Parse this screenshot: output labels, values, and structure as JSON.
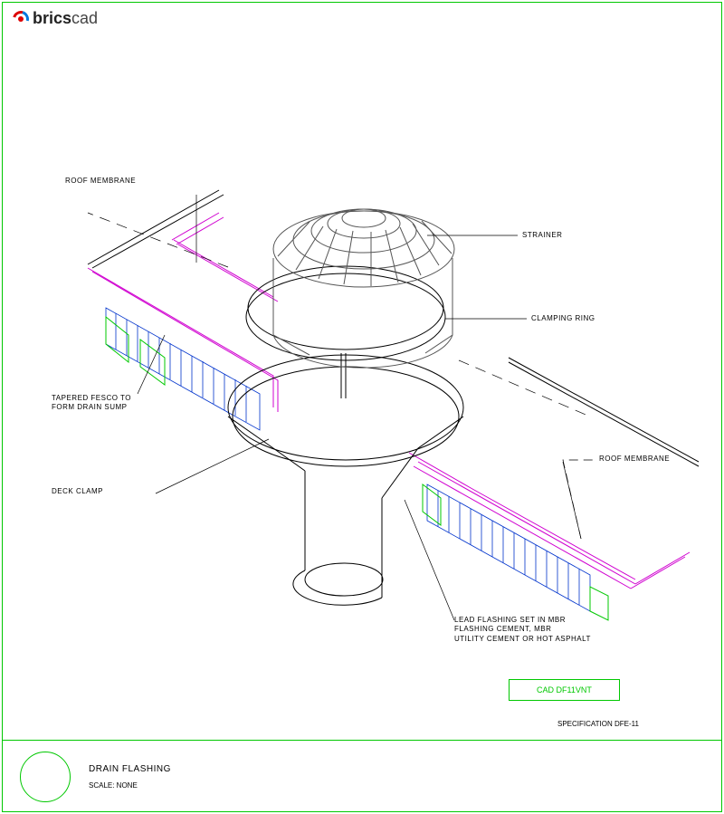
{
  "brand": {
    "prefix": "brics",
    "suffix": "cad"
  },
  "callouts": {
    "roof_membrane_left": "ROOF MEMBRANE",
    "strainer": "STRAINER",
    "clamping_ring": "CLAMPING RING",
    "roof_membrane_right": "ROOF MEMBRANE",
    "tapered_fesco": "TAPERED FESCO TO\nFORM DRAIN SUMP",
    "deck_clamp": "DECK CLAMP",
    "lead_flashing": "LEAD FLASHING SET IN MBR\nFLASHING CEMENT, MBR\nUTILITY CEMENT OR HOT ASPHALT"
  },
  "file_label": "CAD DF11VNT",
  "spec": "SPECIFICATION DFE-11",
  "title_block": {
    "title": "DRAIN FLASHING",
    "scale": "SCALE: NONE"
  }
}
